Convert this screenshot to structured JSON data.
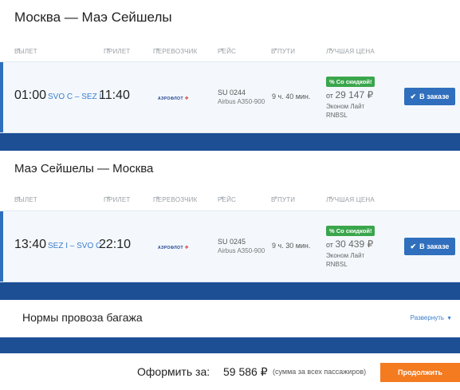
{
  "segments": [
    {
      "title": "Москва — Маэ Сейшелы",
      "headers": {
        "departure": "ВЫЛЕТ",
        "arrival": "ПРИЛЕТ",
        "carrier": "ПЕРЕВОЗЧИК",
        "flight": "РЕЙС",
        "duration": "В ПУТИ",
        "best_price": "ЛУЧШАЯ ЦЕНА"
      },
      "flight": {
        "dep_time": "01:00",
        "airports": "SVO C – SEZ I",
        "arr_time": "11:40",
        "carrier_logo_text": "АЭРОФЛОТ",
        "flight_no": "SU 0244",
        "aircraft": "Airbus A350-900",
        "duration": "9 ч. 40 мин.",
        "discount_badge": "% Со скидкой!",
        "price_prefix": "от",
        "price": "29 147 ₽",
        "fare_name": "Эконом Лайт",
        "fare_code": "RNBSL",
        "button_label": "В заказе"
      }
    },
    {
      "title": "Маэ Сейшелы — Москва",
      "headers": {
        "departure": "ВЫЛЕТ",
        "arrival": "ПРИЛЕТ",
        "carrier": "ПЕРЕВОЗЧИК",
        "flight": "РЕЙС",
        "duration": "В ПУТИ",
        "best_price": "ЛУЧШАЯ ЦЕНА"
      },
      "flight": {
        "dep_time": "13:40",
        "airports": "SEZ I – SVO C",
        "arr_time": "22:10",
        "carrier_logo_text": "АЭРОФЛОТ",
        "flight_no": "SU 0245",
        "aircraft": "Airbus A350-900",
        "duration": "9 ч. 30 мин.",
        "discount_badge": "% Со скидкой!",
        "price_prefix": "от",
        "price": "30 439 ₽",
        "fare_name": "Эконом Лайт",
        "fare_code": "RNBSL",
        "button_label": "В заказе"
      }
    }
  ],
  "baggage": {
    "title": "Нормы провоза багажа",
    "expand_label": "Развернуть"
  },
  "checkout": {
    "label": "Оформить за:",
    "total": "59 586 ₽",
    "note": "(сумма за всех пассажиров)",
    "continue_label": "Продолжить"
  },
  "colors": {
    "accent_blue": "#2f6fbd",
    "band_blue": "#1d4f95",
    "discount_green": "#3aa64c",
    "cta_orange": "#f47b20",
    "link_blue": "#3b7ecb"
  },
  "icons": {
    "sort": "caret-down",
    "check": "checkmark",
    "expand": "chevron-down"
  }
}
